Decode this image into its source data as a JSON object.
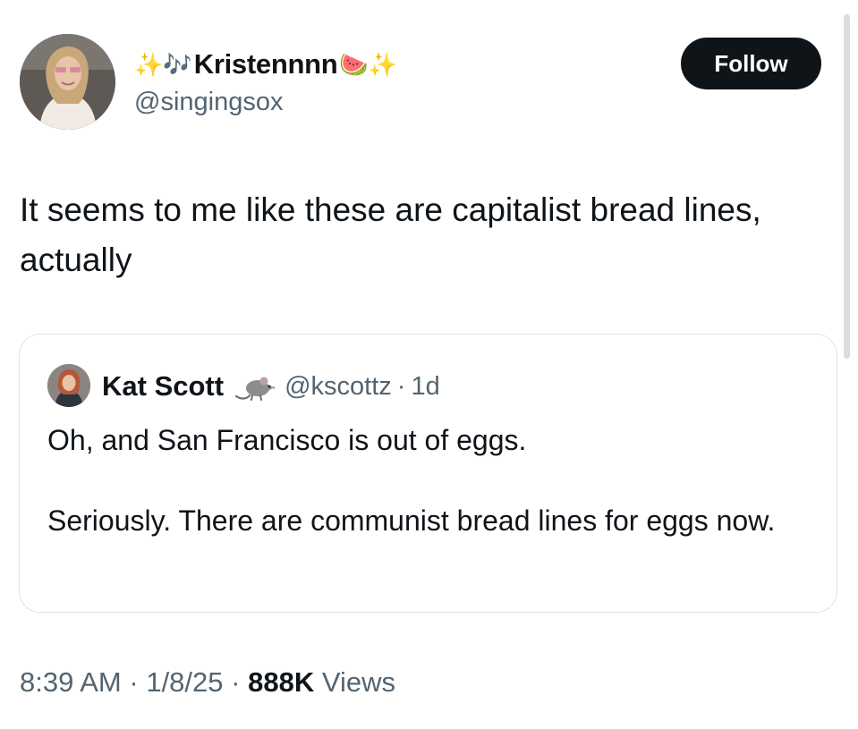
{
  "author": {
    "emoji_left_sparkles": "✨",
    "emoji_left_notes": "🎶",
    "display_name": "Kristennnn",
    "emoji_right_watermelon": "🍉",
    "emoji_right_sparkles": "✨",
    "handle": "@singingsox",
    "avatar_icon": "avatar-photo"
  },
  "follow_label": "Follow",
  "tweet": {
    "text": "It seems to me like these are capitalist bread lines, actually"
  },
  "quoted_tweet": {
    "display_name": "Kat Scott",
    "badge_icon": "rat-emoji",
    "handle": "@kscottz",
    "separator": "·",
    "age": "1d",
    "paragraphs": [
      "Oh, and San Francisco is out of eggs.",
      "Seriously. There are communist bread lines for eggs now."
    ]
  },
  "meta": {
    "time": "8:39 AM",
    "separator_1": "·",
    "date": "1/8/25",
    "separator_2": "·",
    "views_count": "888K",
    "views_label": "Views"
  },
  "colors": {
    "text_primary": "#0f1419",
    "text_secondary": "#536471",
    "follow_bg": "#0f1419",
    "card_border": "#dfe3e7"
  }
}
